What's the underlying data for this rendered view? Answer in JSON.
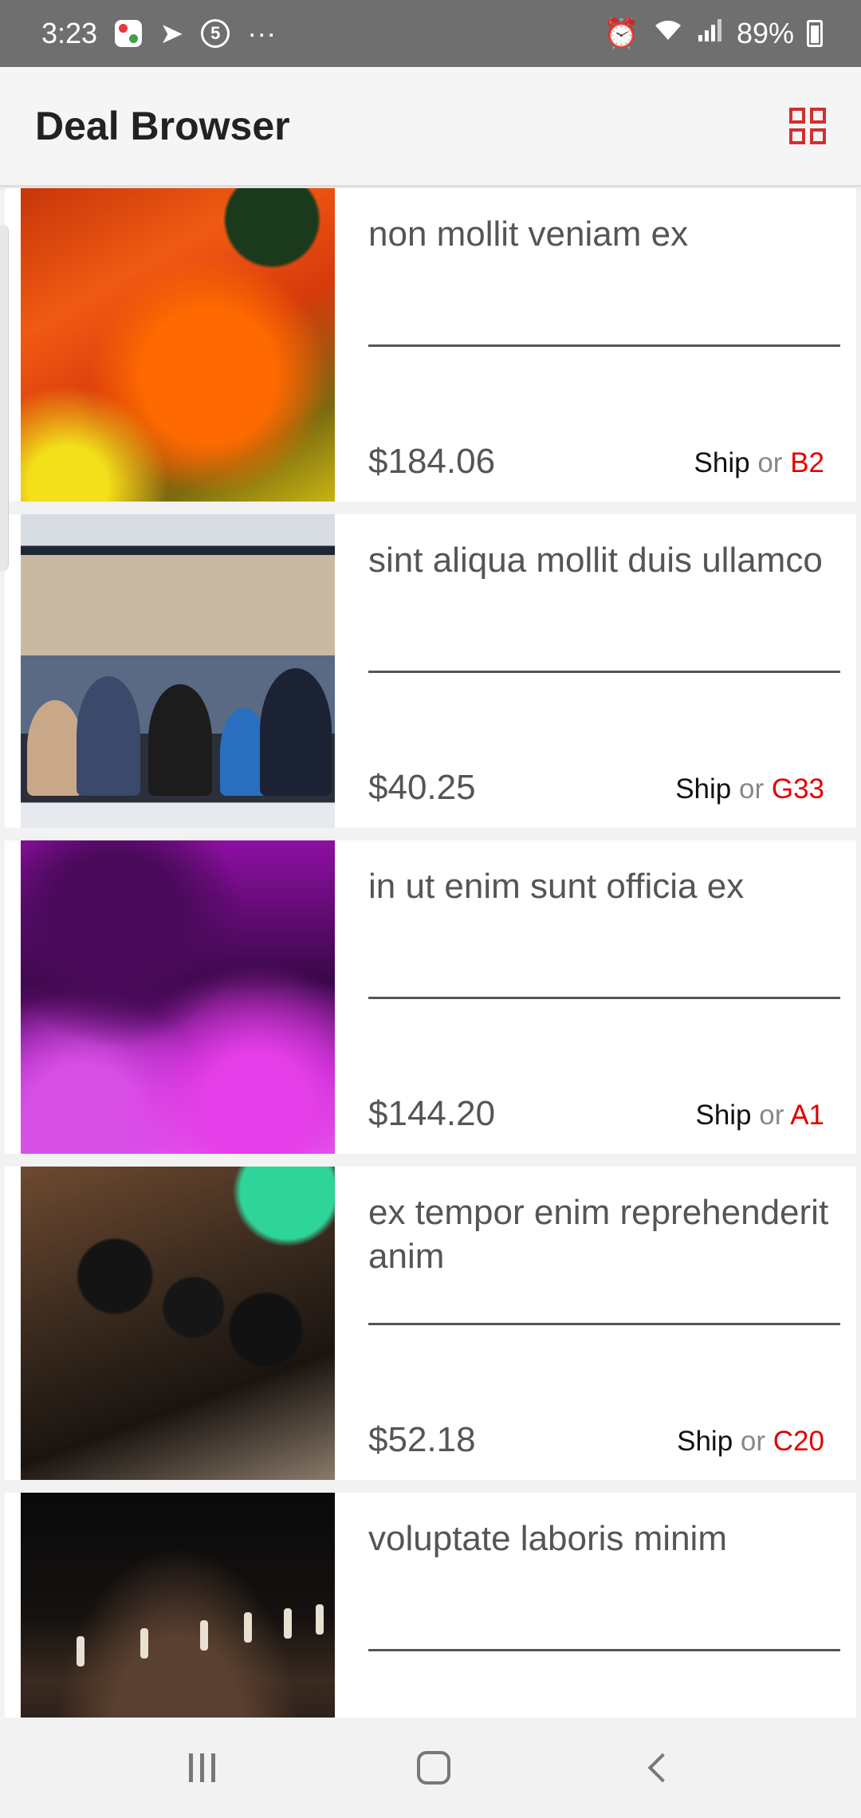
{
  "status_bar": {
    "time": "3:23",
    "dots": "···",
    "battery": "89%",
    "notification_badge": "5"
  },
  "app_bar": {
    "title": "Deal Browser",
    "view_toggle_icon": "grid-view-icon"
  },
  "deals": [
    {
      "title": "non mollit veniam ex",
      "price": "$184.06",
      "ship": "Ship",
      "or": "or",
      "code": "B2"
    },
    {
      "title": "sint aliqua mollit duis ullamco",
      "price": "$40.25",
      "ship": "Ship",
      "or": "or",
      "code": "G33"
    },
    {
      "title": "in ut enim sunt officia ex",
      "price": "$144.20",
      "ship": "Ship",
      "or": "or",
      "code": "A1"
    },
    {
      "title": "ex tempor enim reprehenderit anim",
      "price": "$52.18",
      "ship": "Ship",
      "or": "or",
      "code": "C20"
    },
    {
      "title": "voluptate laboris minim",
      "price": "",
      "ship": "",
      "or": "",
      "code": ""
    }
  ],
  "colors": {
    "accent": "#d32f2f",
    "code_red": "#e30000",
    "status_bar_bg": "#6f6f6f"
  },
  "nav_bar": {
    "recents_icon": "recents-icon",
    "home_icon": "home-icon",
    "back_icon": "back-icon"
  }
}
